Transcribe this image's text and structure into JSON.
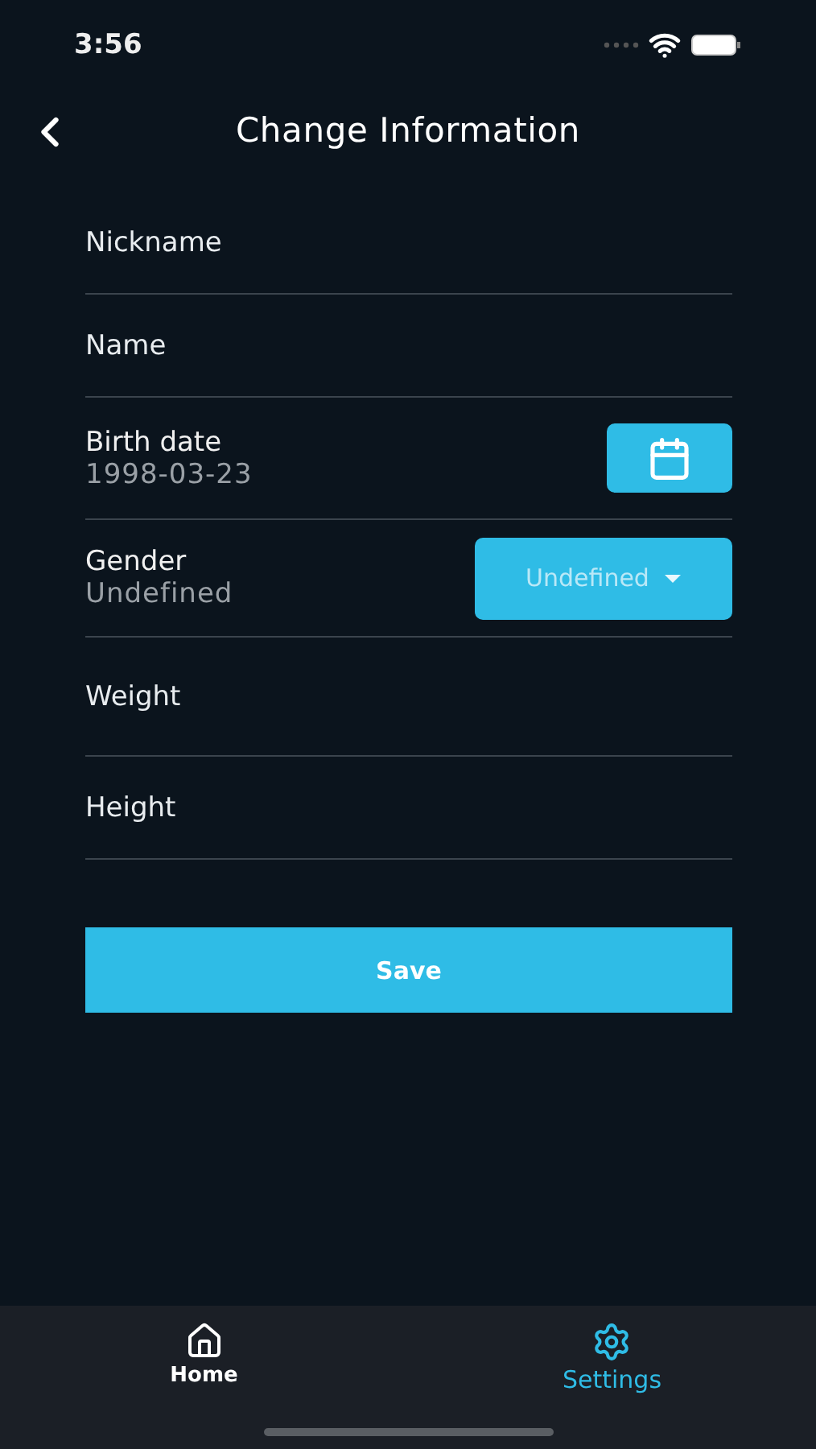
{
  "status_bar": {
    "time": "3:56"
  },
  "header": {
    "title": "Change Information"
  },
  "fields": [
    {
      "kind": "text",
      "placeholder": "Nickname"
    },
    {
      "kind": "text",
      "placeholder": "Name"
    },
    {
      "kind": "date",
      "label": "Birth date",
      "value": "1998-03-23"
    },
    {
      "kind": "select",
      "label": "Gender",
      "value": "Undefined",
      "option": "Undefined"
    },
    {
      "kind": "text",
      "placeholder": "Weight"
    },
    {
      "kind": "text",
      "placeholder": "Height"
    }
  ],
  "save_button": "Save",
  "tabs": [
    {
      "label": "Home",
      "kind": "home",
      "selected": false
    },
    {
      "label": "Settings",
      "kind": "settings",
      "selected": true
    }
  ]
}
